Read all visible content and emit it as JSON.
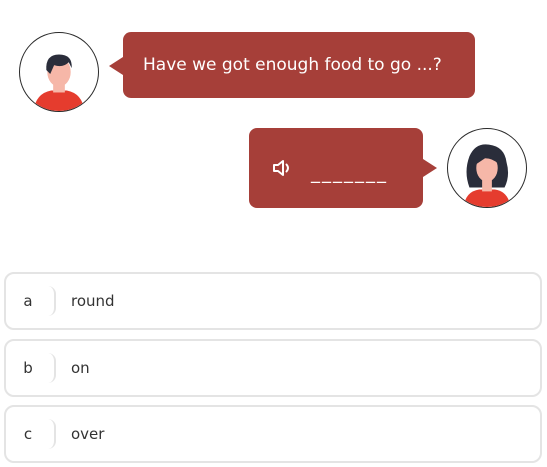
{
  "question": {
    "text": "Have we got enough food to go ...?"
  },
  "answer": {
    "icon": "speaker-icon",
    "blank": "_______"
  },
  "colors": {
    "bubble": "#a63f39",
    "option_border": "#e4e4e4",
    "avatar_shirt": "#e53c2e",
    "avatar_skin": "#f6b7a8",
    "avatar_hair": "#2a2d3a"
  },
  "options": [
    {
      "letter": "a",
      "text": "round"
    },
    {
      "letter": "b",
      "text": "on"
    },
    {
      "letter": "c",
      "text": "over"
    }
  ]
}
